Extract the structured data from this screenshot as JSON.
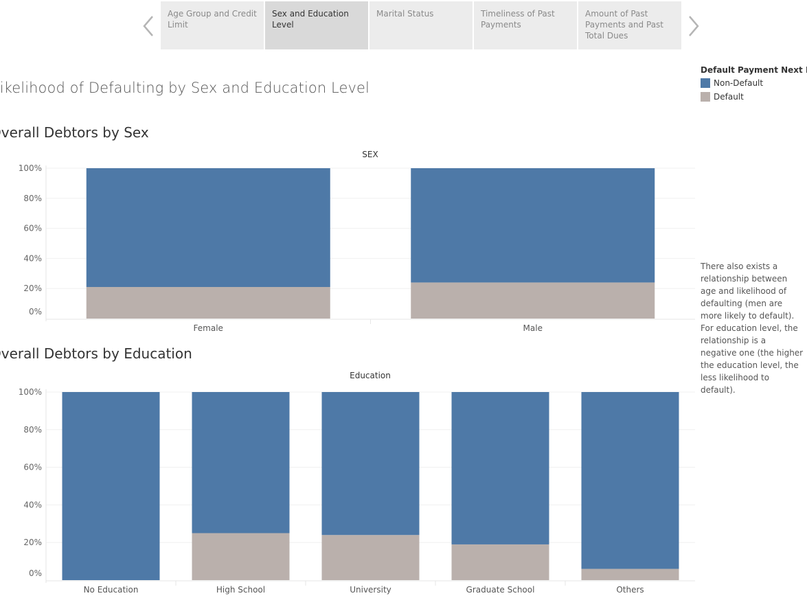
{
  "story": {
    "points": [
      {
        "label": "Age Group and Credit Limit",
        "active": false
      },
      {
        "label": "Sex and Education Level",
        "active": true
      },
      {
        "label": "Marital Status",
        "active": false
      },
      {
        "label": "Timeliness of Past Payments",
        "active": false
      },
      {
        "label": "Amount of Past Payments and Past Total Dues",
        "active": false
      }
    ]
  },
  "main_title": "Likelihood of Defaulting by Sex and Education Level",
  "section1_title": "Overall Debtors by Sex",
  "section2_title": "Overall Debtors by Education",
  "legend": {
    "title": "Default Payment Next M...",
    "items": [
      {
        "label": "Non-Default",
        "color": "#4e79a7"
      },
      {
        "label": "Default",
        "color": "#bab0ac"
      }
    ]
  },
  "note": "There also exists a relationship between age and likelihood of defaulting (men are more likely to default). For education level, the relationship is a negative one (the higher the education level, the less likelihood to default).",
  "chart_data": [
    {
      "type": "bar",
      "stacked": true,
      "normalized": true,
      "title": "SEX",
      "categories": [
        "Female",
        "Male"
      ],
      "series": [
        {
          "name": "Default",
          "values": [
            0.21,
            0.24
          ]
        },
        {
          "name": "Non-Default",
          "values": [
            0.79,
            0.76
          ]
        }
      ],
      "ylim": [
        0,
        1
      ],
      "yticks": [
        "0%",
        "20%",
        "40%",
        "60%",
        "80%",
        "100%"
      ]
    },
    {
      "type": "bar",
      "stacked": true,
      "normalized": true,
      "title": "Education",
      "categories": [
        "No Education",
        "High School",
        "University",
        "Graduate School",
        "Others"
      ],
      "series": [
        {
          "name": "Default",
          "values": [
            0.0,
            0.25,
            0.24,
            0.19,
            0.06
          ]
        },
        {
          "name": "Non-Default",
          "values": [
            1.0,
            0.75,
            0.76,
            0.81,
            0.94
          ]
        }
      ],
      "ylim": [
        0,
        1
      ],
      "yticks": [
        "0%",
        "20%",
        "40%",
        "60%",
        "80%",
        "100%"
      ]
    }
  ]
}
